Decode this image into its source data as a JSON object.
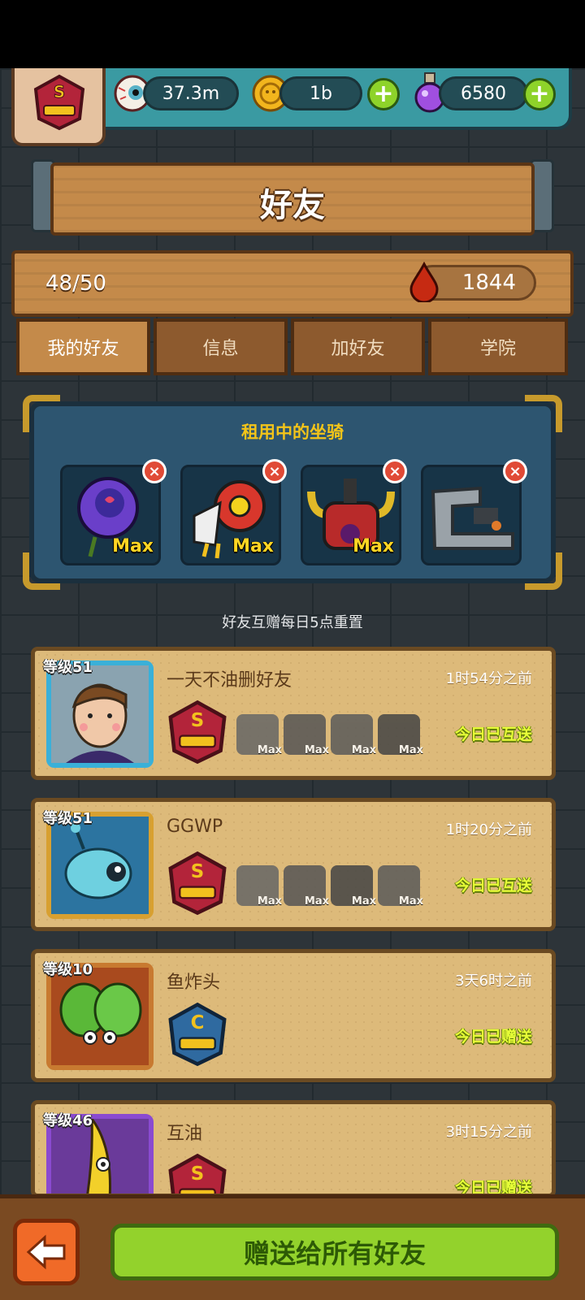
{
  "resources": {
    "eyes": "37.3m",
    "coins": "1b",
    "potions": "6580"
  },
  "page_title": "好友",
  "friend_count": "48/50",
  "blood": "1844",
  "tabs": [
    "我的好友",
    "信息",
    "加好友",
    "学院"
  ],
  "rented_mounts": {
    "title": "租用中的坐骑",
    "max_label": "Max",
    "mounts": [
      "rose-mount",
      "lion-dance-mount",
      "horned-demon-mount",
      "machine-mount"
    ]
  },
  "reset_note": "好友互赠每日5点重置",
  "friends": [
    {
      "level": "等级51",
      "name": "一天不油删好友",
      "time": "1时54分之前",
      "status": "今日已互送",
      "rank": "S",
      "mounts": 4
    },
    {
      "level": "等级51",
      "name": "GGWP",
      "time": "1时20分之前",
      "status": "今日已互送",
      "rank": "S",
      "mounts": 4
    },
    {
      "level": "等级10",
      "name": "鱼炸头",
      "time": "3天6时之前",
      "status": "今日已赠送",
      "rank": "C",
      "mounts": 0
    },
    {
      "level": "等级46",
      "name": "互油",
      "time": "3时15分之前",
      "status": "今日已赠送",
      "rank": "S",
      "mounts": 0
    }
  ],
  "mini_max_label": "Max",
  "badge_rank": "S",
  "send_all_label": "赠送给所有好友",
  "colors": {
    "teal_bar": "#3a9aa2",
    "wood": "#c48a4a",
    "panel_blue": "#2d5570",
    "card": "#ddba7a",
    "green_button": "#93d22c",
    "status_yellow": "#e8ff38"
  }
}
